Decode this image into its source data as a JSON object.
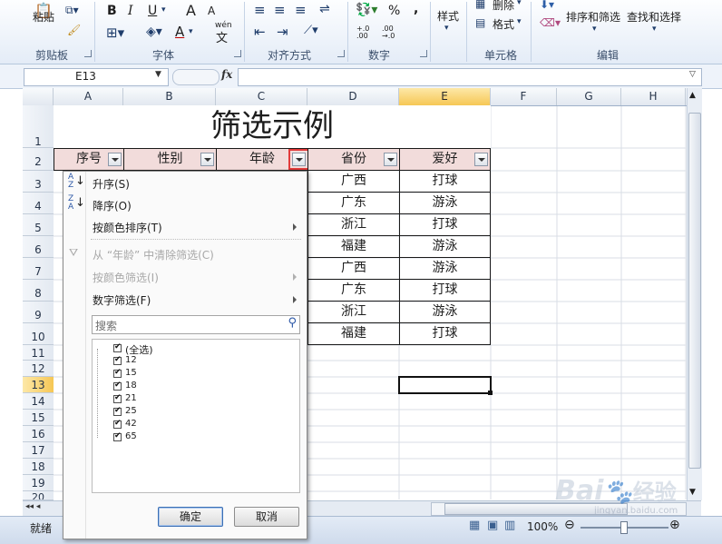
{
  "ribbon": {
    "paste": "粘贴",
    "group_clipboard": "剪贴板",
    "group_font": "字体",
    "group_align": "对齐方式",
    "group_number": "数字",
    "group_cells": "单元格",
    "group_edit": "编辑",
    "bold": "B",
    "italic": "I",
    "underline": "U",
    "font_grow": "A",
    "font_shrink": "A",
    "wen": "wén",
    "wen_char": "文",
    "percent": "%",
    "comma": ",",
    "dec_inc": "+.0 .00",
    "dec_dec": ".00 →.0",
    "style": "样式",
    "delete": "删除",
    "format": "格式",
    "sort_filter": "排序和筛选",
    "find_select": "查找和选择"
  },
  "formula_bar": {
    "namebox": "E13",
    "fx": "fx",
    "value": ""
  },
  "columns": [
    "A",
    "B",
    "C",
    "D",
    "E",
    "F",
    "G",
    "H"
  ],
  "rows": [
    "1",
    "2",
    "3",
    "4",
    "5",
    "6",
    "7",
    "8",
    "9",
    "10",
    "11",
    "12",
    "13",
    "14",
    "15",
    "16",
    "17",
    "18",
    "19",
    "20"
  ],
  "sheet": {
    "title": "筛选示例",
    "headers": [
      "序号",
      "性别",
      "年龄",
      "省份",
      "爱好"
    ],
    "provinces": [
      "广西",
      "广东",
      "浙江",
      "福建",
      "广西",
      "广东",
      "浙江",
      "福建"
    ],
    "hobbies": [
      "打球",
      "游泳",
      "打球",
      "游泳",
      "游泳",
      "打球",
      "游泳",
      "打球"
    ]
  },
  "menu": {
    "sort_asc": "升序(S)",
    "sort_desc": "降序(O)",
    "sort_color": "按颜色排序(T)",
    "clear_filter": "从 “年龄” 中清除筛选(C)",
    "filter_color": "按颜色筛选(I)",
    "number_filter": "数字筛选(F)",
    "search_placeholder": "搜索",
    "items": [
      "(全选)",
      "12",
      "15",
      "18",
      "21",
      "25",
      "42",
      "65"
    ],
    "ok": "确定",
    "cancel": "取消"
  },
  "status": {
    "ready": "就绪",
    "zoom": "100%"
  },
  "watermark": {
    "line1": "Bai",
    "line2": "经验",
    "url": "jingyan.baidu.com"
  }
}
